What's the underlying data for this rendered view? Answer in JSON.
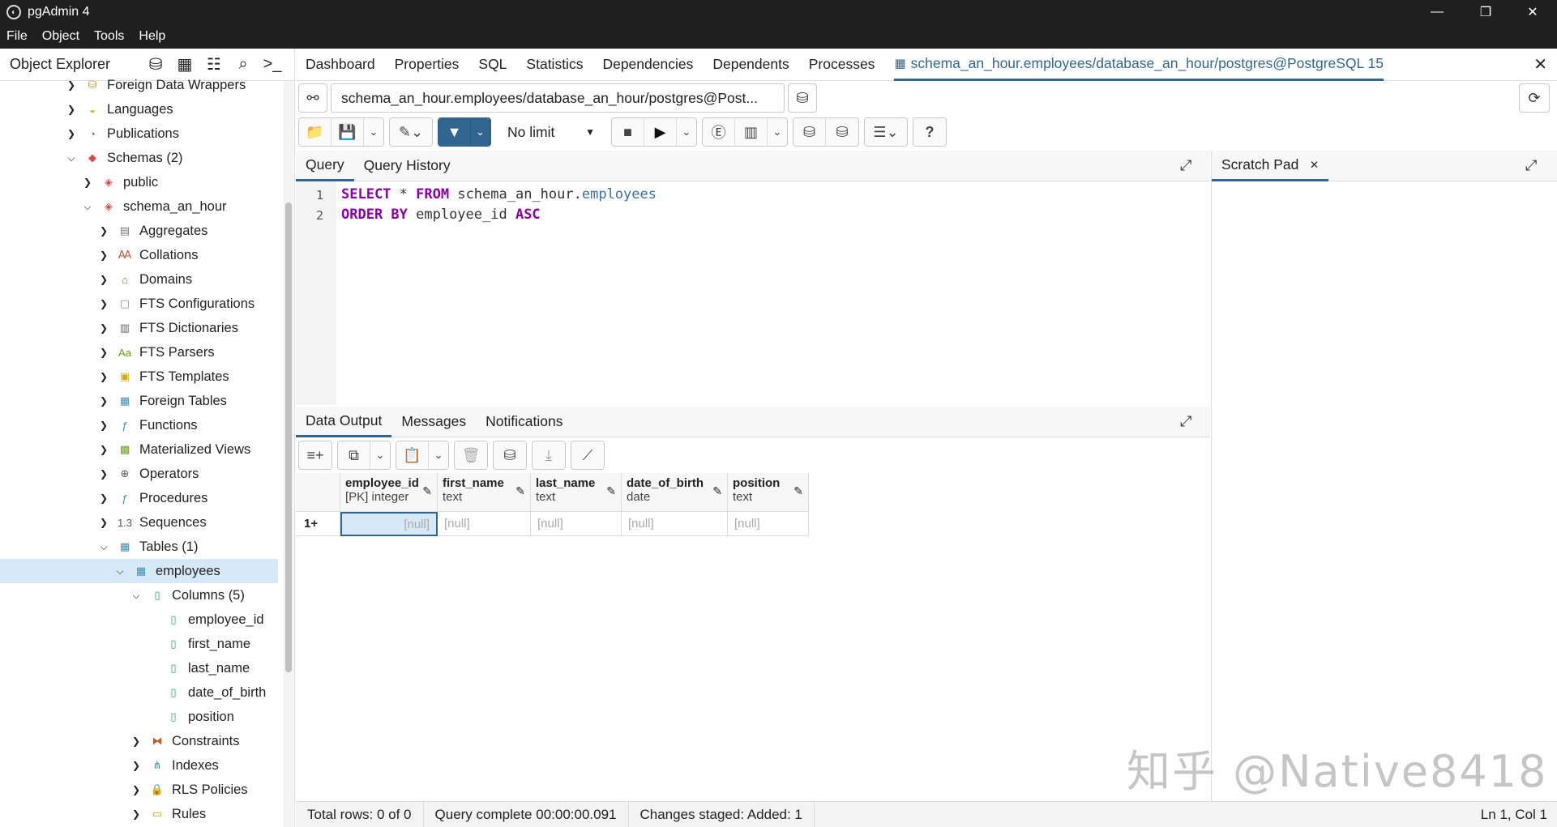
{
  "window": {
    "title": "pgAdmin 4",
    "controls": [
      "—",
      "❐",
      "✕"
    ]
  },
  "menu": [
    "File",
    "Object",
    "Tools",
    "Help"
  ],
  "explorer": {
    "title": "Object Explorer",
    "tree": [
      {
        "label": "Foreign Data Wrappers",
        "depth": 0,
        "chev": "›",
        "icon": "foreign-data-wrapper-icon"
      },
      {
        "label": "Languages",
        "depth": 0,
        "chev": "›",
        "icon": "language-icon"
      },
      {
        "label": "Publications",
        "depth": 0,
        "chev": "›",
        "icon": "publication-icon"
      },
      {
        "label": "Schemas (2)",
        "depth": 0,
        "chev": "⌄",
        "icon": "schemas-icon"
      },
      {
        "label": "public",
        "depth": 1,
        "chev": "›",
        "icon": "schema-icon"
      },
      {
        "label": "schema_an_hour",
        "depth": 1,
        "chev": "⌄",
        "icon": "schema-icon"
      },
      {
        "label": "Aggregates",
        "depth": 2,
        "chev": "›",
        "icon": "aggregate-icon"
      },
      {
        "label": "Collations",
        "depth": 2,
        "chev": "›",
        "icon": "collation-icon"
      },
      {
        "label": "Domains",
        "depth": 2,
        "chev": "›",
        "icon": "domain-icon"
      },
      {
        "label": "FTS Configurations",
        "depth": 2,
        "chev": "›",
        "icon": "fts-configuration-icon"
      },
      {
        "label": "FTS Dictionaries",
        "depth": 2,
        "chev": "›",
        "icon": "fts-dictionary-icon"
      },
      {
        "label": "FTS Parsers",
        "depth": 2,
        "chev": "›",
        "icon": "fts-parser-icon"
      },
      {
        "label": "FTS Templates",
        "depth": 2,
        "chev": "›",
        "icon": "fts-template-icon"
      },
      {
        "label": "Foreign Tables",
        "depth": 2,
        "chev": "›",
        "icon": "foreign-table-icon"
      },
      {
        "label": "Functions",
        "depth": 2,
        "chev": "›",
        "icon": "function-icon"
      },
      {
        "label": "Materialized Views",
        "depth": 2,
        "chev": "›",
        "icon": "materialized-view-icon"
      },
      {
        "label": "Operators",
        "depth": 2,
        "chev": "›",
        "icon": "operator-icon"
      },
      {
        "label": "Procedures",
        "depth": 2,
        "chev": "›",
        "icon": "procedure-icon"
      },
      {
        "label": "Sequences",
        "depth": 2,
        "chev": "›",
        "icon": "sequence-icon"
      },
      {
        "label": "Tables (1)",
        "depth": 2,
        "chev": "⌄",
        "icon": "tables-icon"
      },
      {
        "label": "employees",
        "depth": 3,
        "chev": "⌄",
        "icon": "table-icon",
        "selected": true
      },
      {
        "label": "Columns (5)",
        "depth": 4,
        "chev": "⌄",
        "icon": "columns-icon"
      },
      {
        "label": "employee_id",
        "depth": 5,
        "chev": "",
        "icon": "column-icon"
      },
      {
        "label": "first_name",
        "depth": 5,
        "chev": "",
        "icon": "column-icon"
      },
      {
        "label": "last_name",
        "depth": 5,
        "chev": "",
        "icon": "column-icon"
      },
      {
        "label": "date_of_birth",
        "depth": 5,
        "chev": "",
        "icon": "column-icon"
      },
      {
        "label": "position",
        "depth": 5,
        "chev": "",
        "icon": "column-icon"
      },
      {
        "label": "Constraints",
        "depth": 4,
        "chev": "›",
        "icon": "constraint-icon"
      },
      {
        "label": "Indexes",
        "depth": 4,
        "chev": "›",
        "icon": "index-icon"
      },
      {
        "label": "RLS Policies",
        "depth": 4,
        "chev": "›",
        "icon": "rls-policy-icon"
      },
      {
        "label": "Rules",
        "depth": 4,
        "chev": "›",
        "icon": "rule-icon"
      }
    ]
  },
  "main_tabs": [
    "Dashboard",
    "Properties",
    "SQL",
    "Statistics",
    "Dependencies",
    "Dependents",
    "Processes"
  ],
  "active_tab": "schema_an_hour.employees/database_an_hour/postgres@PostgreSQL 15",
  "connection": "schema_an_hour.employees/database_an_hour/postgres@Post...",
  "toolbar": {
    "row_limit": "No limit"
  },
  "query_tabs": [
    "Query",
    "Query History"
  ],
  "editor": {
    "line_numbers": [
      "1",
      "2"
    ],
    "line1": {
      "kw1": "SELECT",
      "rest1": " * ",
      "kw2": "FROM",
      "schema": " schema_an_hour.",
      "table": "employees"
    },
    "line2": {
      "kw1": "ORDER BY",
      "col": " employee_id ",
      "kw2": "ASC"
    }
  },
  "scratch_pad": {
    "title": "Scratch Pad",
    "close": "×"
  },
  "output_tabs": [
    "Data Output",
    "Messages",
    "Notifications"
  ],
  "grid": {
    "columns": [
      {
        "name": "employee_id",
        "type": "[PK] integer"
      },
      {
        "name": "first_name",
        "type": "text"
      },
      {
        "name": "last_name",
        "type": "text"
      },
      {
        "name": "date_of_birth",
        "type": "date"
      },
      {
        "name": "position",
        "type": "text"
      }
    ],
    "row_label": "1+",
    "null_text": "[null]"
  },
  "status": {
    "total_rows": "Total rows: 0 of 0",
    "query_complete": "Query complete 00:00:00.091",
    "changes": "Changes staged: Added: 1",
    "cursor": "Ln 1, Col 1"
  },
  "watermark": "知乎 @Native8418",
  "colors": {
    "accent": "#326690",
    "keyword": "#8b00a8",
    "selection": "#d7e9f7"
  }
}
